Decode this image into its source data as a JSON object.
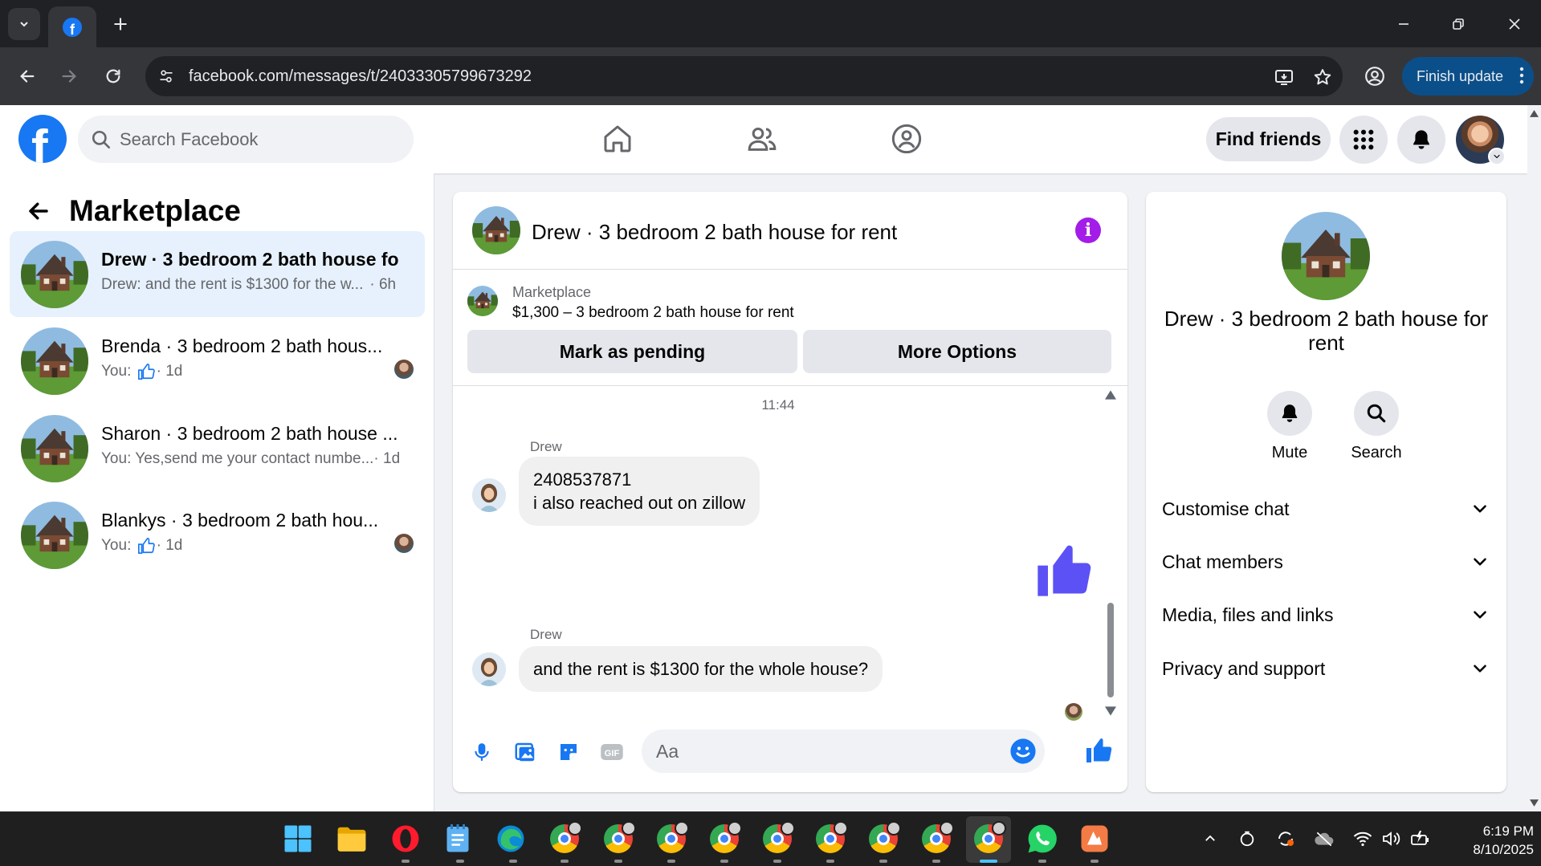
{
  "browser": {
    "url": "facebook.com/messages/t/24033305799673292",
    "update_label": "Finish update"
  },
  "header": {
    "search_placeholder": "Search Facebook",
    "find_friends": "Find friends"
  },
  "sidebar": {
    "title": "Marketplace",
    "conversations": [
      {
        "title": "Drew · 3 bedroom 2 bath house fo...",
        "preview": "Drew: and the rent is $1300 for the w...",
        "time": "· 6h",
        "like": false
      },
      {
        "title": "Brenda · 3 bedroom 2 bath hous...",
        "preview": "You: ",
        "time": "· 1d",
        "like": true
      },
      {
        "title": "Sharon · 3 bedroom 2 bath house ...",
        "preview": "You: Yes,send me your contact numbe...",
        "time": "· 1d",
        "like": false
      },
      {
        "title": "Blankys · 3 bedroom 2 bath hou...",
        "preview": "You: ",
        "time": "· 1d",
        "like": true
      }
    ]
  },
  "chat": {
    "title": "Drew · 3 bedroom 2 bath house for rent",
    "listing_label": "Marketplace",
    "listing_price": "$1,300 – 3 bedroom 2 bath house for rent",
    "mark_pending": "Mark as pending",
    "more_options": "More Options",
    "timestamp": "11:44",
    "messages": [
      {
        "sender": "Drew",
        "lines": [
          "2408537871",
          "i also reached out on zillow"
        ]
      },
      {
        "sender": "Drew",
        "lines": [
          "and the rent is $1300 for the whole house?"
        ]
      }
    ],
    "composer_placeholder": "Aa"
  },
  "info": {
    "title": "Drew · 3 bedroom 2 bath house for rent",
    "mute": "Mute",
    "search": "Search",
    "sections": [
      "Customise chat",
      "Chat members",
      "Media, files and links",
      "Privacy and support"
    ]
  },
  "taskbar": {
    "time": "6:19 PM",
    "date": "8/10/2025"
  },
  "colors": {
    "facebook_blue": "#1877f2",
    "active_conversation": "#e7f1fd",
    "info_purple": "#a31ce8",
    "sent_like": "#5b51f5"
  }
}
